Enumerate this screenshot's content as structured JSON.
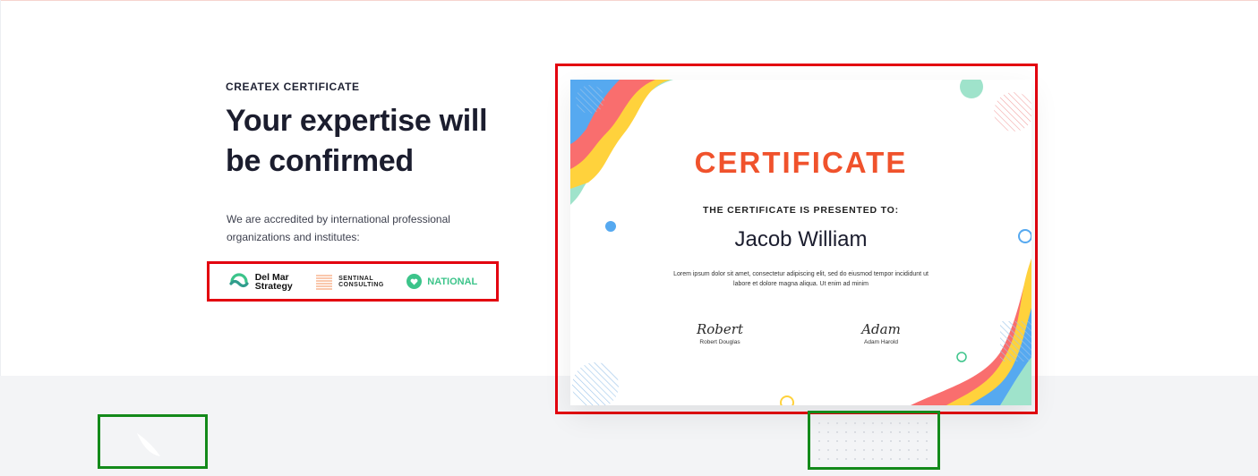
{
  "section": {
    "eyebrow": "CREATEX CERTIFICATE",
    "headline": "Your expertise will be confirmed",
    "description": "We are accredited by international professional organizations and institutes:"
  },
  "partners": [
    {
      "name": "Del Mar Strategy",
      "line1": "Del Mar",
      "line2": "Strategy",
      "icon": "wave-logo-icon"
    },
    {
      "name": "Sentinal Consulting",
      "line1": "SENTINAL",
      "line2": "CONSULTING",
      "icon": "stripes-logo-icon"
    },
    {
      "name": "National",
      "line1": "NATIONAL",
      "icon": "heart-badge-icon"
    }
  ],
  "certificate": {
    "title": "CERTIFICATE",
    "subtitle": "THE CERTIFICATE IS PRESENTED TO:",
    "recipient": "Jacob William",
    "body": "Lorem ipsum dolor sit amet, consectetur adipiscing elit, sed do eiusmod tempor incididunt ut labore et dolore magna aliqua. Ut enim ad minim",
    "signatures": [
      {
        "script": "Robert",
        "name": "Robert Douglas"
      },
      {
        "script": "Adam",
        "name": "Adam Harold"
      }
    ]
  },
  "colors": {
    "highlight_red": "#e3000f",
    "highlight_green": "#138a1a",
    "cert_title": "#f0522c",
    "national_green": "#3cc48a"
  }
}
